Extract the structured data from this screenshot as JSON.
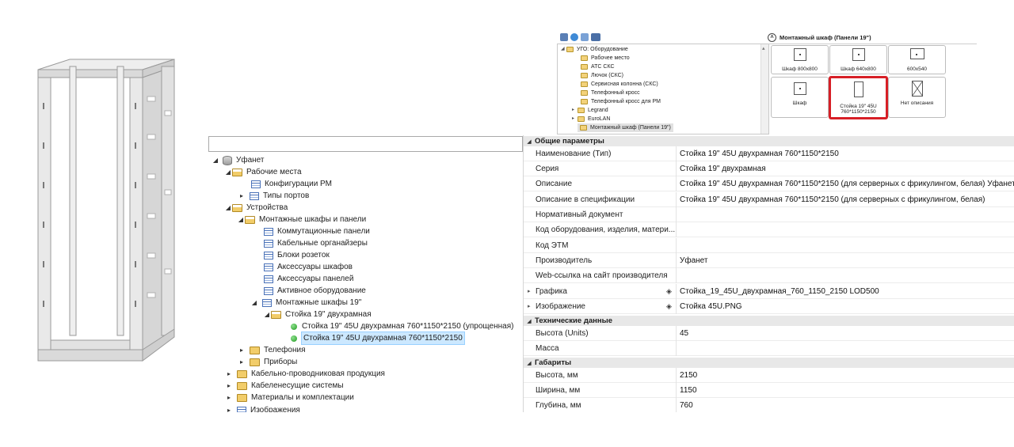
{
  "ugo_tree": {
    "items": [
      "УГО: Оборудование",
      "Рабочее место",
      "АТС СКС",
      "Лючок (СКС)",
      "Сервисная колонна (СКС)",
      "Телефонный кросс",
      "Телефонный кросс для РМ",
      "Legrand",
      "EuroLAN",
      "Монтажный шкаф (Панели 19\")"
    ]
  },
  "gallery": {
    "title": "Монтажный шкаф (Панели 19\")",
    "items": [
      "Шкаф 800x800",
      "Шкаф 640x800",
      "600x540",
      "Шкаф",
      "Стойка 19\" 45U 760*1150*2150",
      "Нет описания"
    ],
    "selected_color": "#d71f26"
  },
  "tree": {
    "search_value": "",
    "items": [
      "Уфанет",
      "Рабочие места",
      "Конфигурации РМ",
      "Типы портов",
      "Устройства",
      "Монтажные шкафы и панели",
      "Коммутационные панели",
      "Кабельные органайзеры",
      "Блоки розеток",
      "Аксессуары шкафов",
      "Аксессуары панелей",
      "Активное оборудование",
      "Монтажные шкафы 19\"",
      "Стойка 19\" двухрамная",
      "Стойка 19\" 45U двухрамная 760*1150*2150 (упрощенная)",
      "Стойка 19\" 45U двухрамная 760*1150*2150",
      "Телефония",
      "Приборы",
      "Кабельно-проводниковая продукция",
      "Кабеленесущие системы",
      "Материалы и комплектации",
      "Изображения"
    ]
  },
  "props": {
    "cat_general": "Общие параметры",
    "cat_tech": "Технические данные",
    "cat_dims": "Габариты",
    "general": [
      {
        "name": "Наименование (Тип)",
        "value": "Стойка 19\" 45U двухрамная 760*1150*2150"
      },
      {
        "name": "Серия",
        "value": "Стойка 19\" двухрамная"
      },
      {
        "name": "Описание",
        "value": "Стойка 19\" 45U двухрамная 760*1150*2150 (для серверных с фрикулингом, белая) Уфанет"
      },
      {
        "name": "Описание в спецификации",
        "value": "Стойка 19\" 45U двухрамная 760*1150*2150 (для серверных с фрикулингом, белая)"
      },
      {
        "name": "Нормативный документ",
        "value": ""
      },
      {
        "name": "Код оборудования, изделия, матери...",
        "value": ""
      },
      {
        "name": "Код ЭТМ",
        "value": ""
      },
      {
        "name": "Производитель",
        "value": "Уфанет"
      },
      {
        "name": "Web-ссылка на сайт производителя",
        "value": ""
      },
      {
        "name": "Графика",
        "value": "Стойка_19_45U_двухрамная_760_1150_2150 LOD500"
      },
      {
        "name": "Изображение",
        "value": "Стойка 45U.PNG"
      }
    ],
    "tech": [
      {
        "name": "Высота (Units)",
        "value": "45"
      },
      {
        "name": "Масса",
        "value": ""
      }
    ],
    "dims": [
      {
        "name": "Высота, мм",
        "value": "2150"
      },
      {
        "name": "Ширина, мм",
        "value": "1150"
      },
      {
        "name": "Глубина, мм",
        "value": "760"
      }
    ]
  }
}
